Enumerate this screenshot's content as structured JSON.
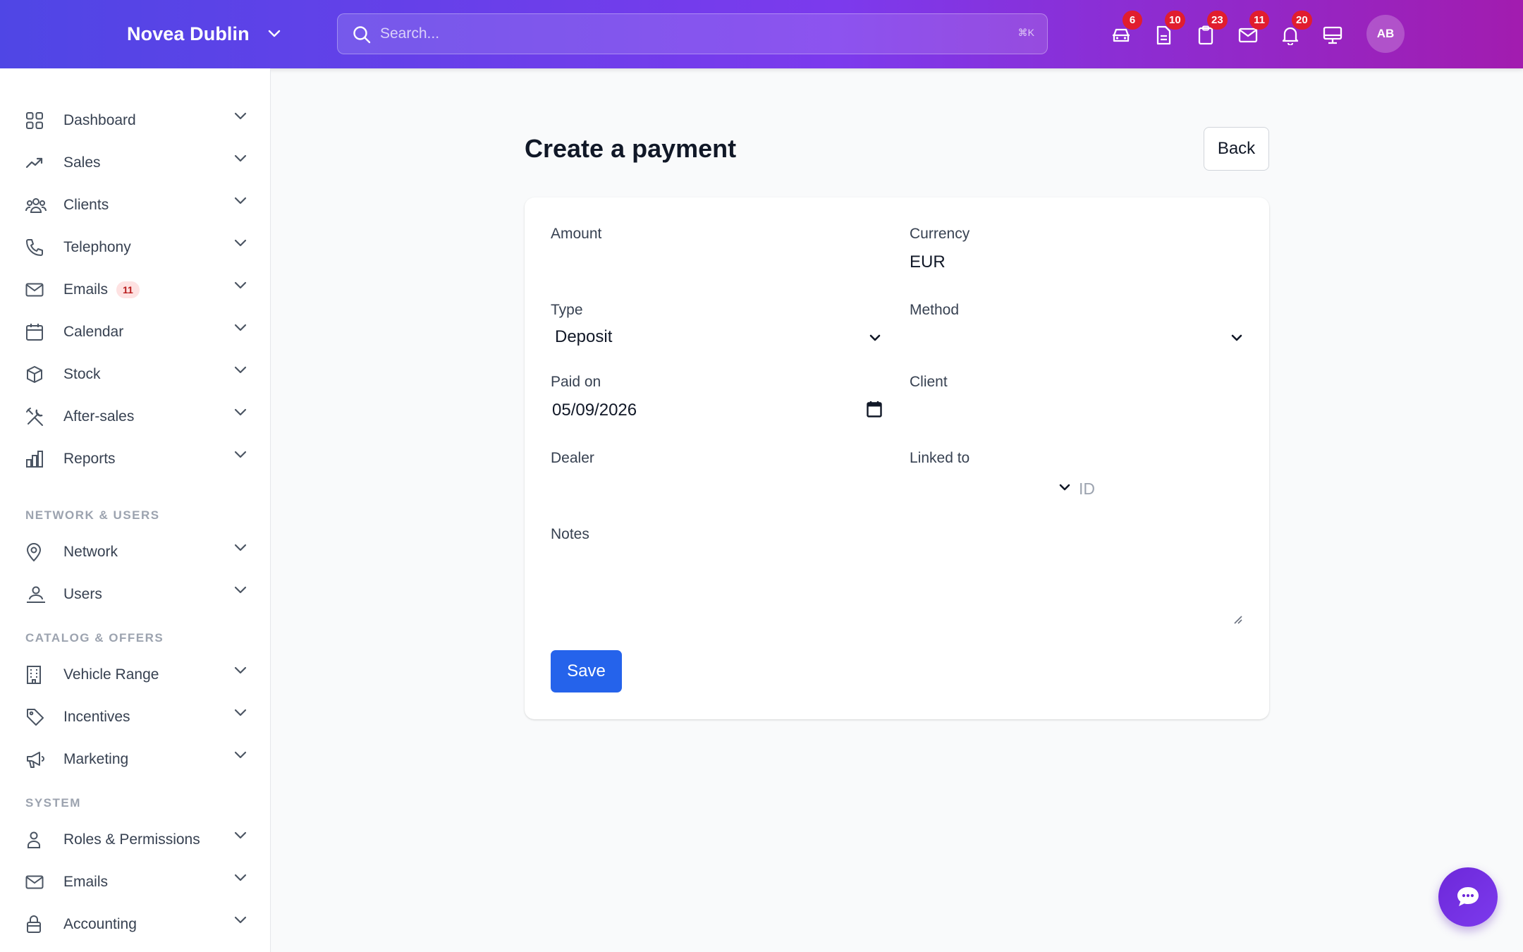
{
  "header": {
    "brand_name": "Novea Dublin",
    "search_placeholder": "Search...",
    "search_shortcut": "⌘K",
    "badges": {
      "cars": "6",
      "documents": "10",
      "clipboard": "23",
      "mail": "11",
      "notifications": "20"
    },
    "avatar_initials": "AB"
  },
  "sidebar": {
    "items": [
      {
        "label": "Dashboard",
        "icon": "grid-icon"
      },
      {
        "label": "Sales",
        "icon": "trending-up-icon"
      },
      {
        "label": "Clients",
        "icon": "users-icon"
      },
      {
        "label": "Telephony",
        "icon": "phone-icon"
      },
      {
        "label": "Emails",
        "icon": "mail-icon",
        "badge": "11"
      },
      {
        "label": "Calendar",
        "icon": "calendar-icon"
      },
      {
        "label": "Stock",
        "icon": "cube-icon"
      },
      {
        "label": "After-sales",
        "icon": "tools-icon"
      },
      {
        "label": "Reports",
        "icon": "bar-chart-icon"
      }
    ],
    "sections": [
      {
        "title": "NETWORK & USERS",
        "items": [
          {
            "label": "Network",
            "icon": "map-pin-icon"
          },
          {
            "label": "Users",
            "icon": "user-group-icon"
          }
        ]
      },
      {
        "title": "CATALOG & OFFERS",
        "items": [
          {
            "label": "Vehicle Range",
            "icon": "building-icon"
          },
          {
            "label": "Incentives",
            "icon": "tag-icon"
          },
          {
            "label": "Marketing",
            "icon": "megaphone-icon"
          }
        ]
      },
      {
        "title": "SYSTEM",
        "items": [
          {
            "label": "Roles & Permissions",
            "icon": "user-icon"
          },
          {
            "label": "Emails",
            "icon": "mail-icon"
          },
          {
            "label": "Accounting",
            "icon": "lock-bag-icon"
          }
        ]
      }
    ]
  },
  "main": {
    "title": "Create a payment",
    "back_label": "Back",
    "form": {
      "amount_label": "Amount",
      "currency_label": "Currency",
      "currency_value": "EUR",
      "type_label": "Type",
      "type_value": "Deposit",
      "method_label": "Method",
      "paid_on_label": "Paid on",
      "paid_on_value": "05/09/2026",
      "client_label": "Client",
      "dealer_label": "Dealer",
      "linked_to_label": "Linked to",
      "linked_id_placeholder": "ID",
      "notes_label": "Notes",
      "save_label": "Save"
    }
  },
  "colors": {
    "brand_gradient_start": "#4f46e5",
    "brand_gradient_end": "#a21caf",
    "primary": "#2563eb",
    "badge_red": "#e11d2e"
  }
}
